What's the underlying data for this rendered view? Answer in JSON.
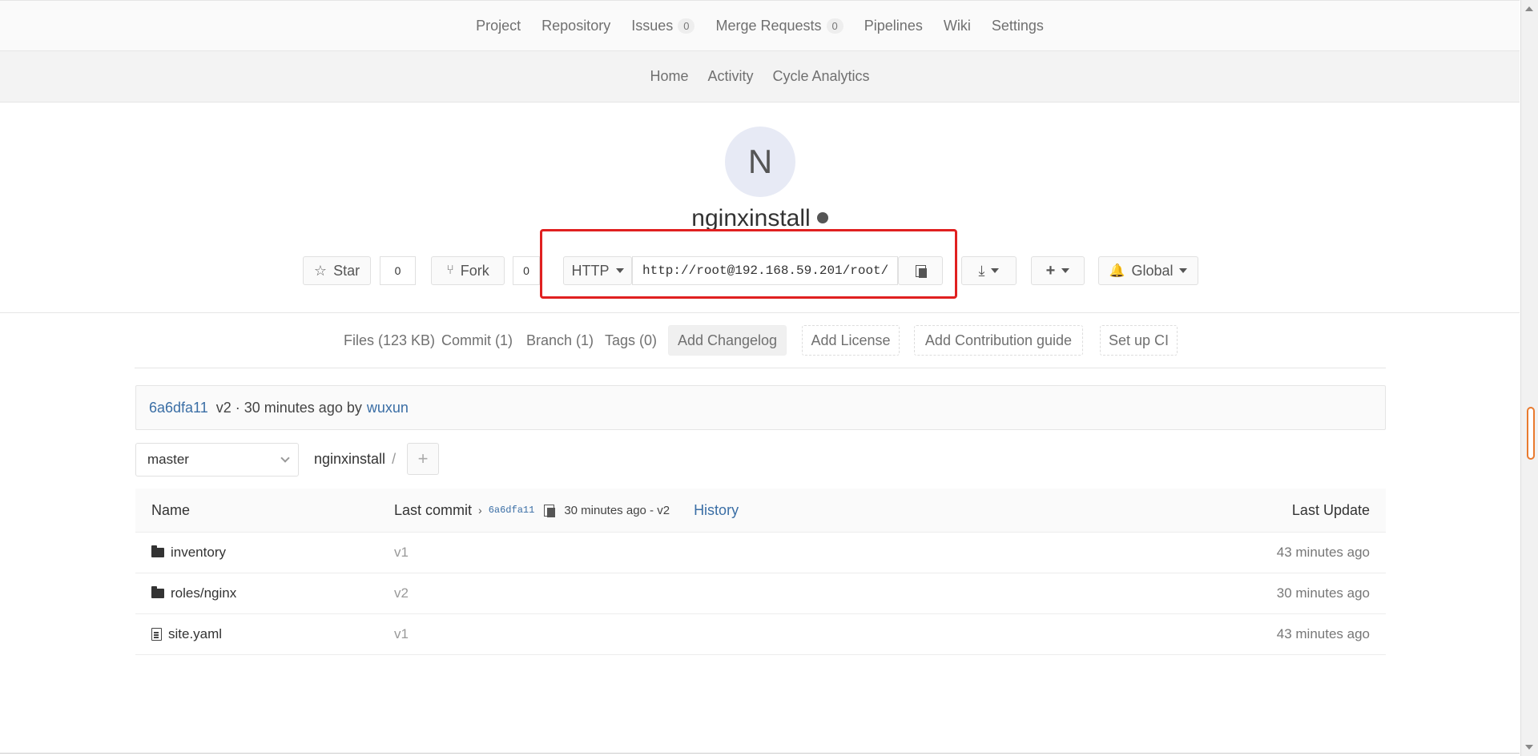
{
  "top_nav": {
    "items": [
      {
        "label": "Project"
      },
      {
        "label": "Repository"
      },
      {
        "label": "Issues",
        "badge": "0"
      },
      {
        "label": "Merge Requests",
        "badge": "0"
      },
      {
        "label": "Pipelines"
      },
      {
        "label": "Wiki"
      },
      {
        "label": "Settings"
      }
    ]
  },
  "sub_nav": {
    "items": [
      {
        "label": "Home"
      },
      {
        "label": "Activity"
      },
      {
        "label": "Cycle Analytics"
      }
    ]
  },
  "project": {
    "avatar_letter": "N",
    "name": "nginxinstall",
    "visibility_icon": "globe-icon"
  },
  "actions": {
    "star_label": "Star",
    "star_count": "0",
    "fork_label": "Fork",
    "fork_count": "0",
    "protocol": "HTTP",
    "clone_url": "http://root@192.168.59.201/root/",
    "notification_label": "Global"
  },
  "stats": {
    "files": "Files (123 KB)",
    "commits": "Commit (1)",
    "branches": "Branch (1)",
    "tags": "Tags (0)",
    "add_changelog": "Add Changelog",
    "add_license": "Add License",
    "add_contribution": "Add Contribution guide",
    "setup_ci": "Set up CI"
  },
  "last_commit": {
    "sha": "6a6dfa11",
    "summary": "v2 · 30 minutes ago by",
    "author": "wuxun"
  },
  "tree": {
    "branch": "master",
    "path_root": "nginxinstall",
    "path_sep": "/",
    "add_icon": "plus-icon"
  },
  "files_table": {
    "headers": {
      "name": "Name",
      "last_commit": "Last commit",
      "sha": "6a6dfa11",
      "commit_meta": "30 minutes ago - v2",
      "history": "History",
      "last_update": "Last Update"
    },
    "rows": [
      {
        "type": "folder",
        "name": "inventory",
        "commit": "v1",
        "updated": "43 minutes ago"
      },
      {
        "type": "folder",
        "name": "roles/nginx",
        "commit": "v2",
        "updated": "30 minutes ago"
      },
      {
        "type": "file",
        "name": "site.yaml",
        "commit": "v1",
        "updated": "43 minutes ago"
      }
    ]
  },
  "colors": {
    "highlight": "#e02020",
    "link": "#3a6ea5",
    "scroll_thumb": "#e97a2e"
  }
}
